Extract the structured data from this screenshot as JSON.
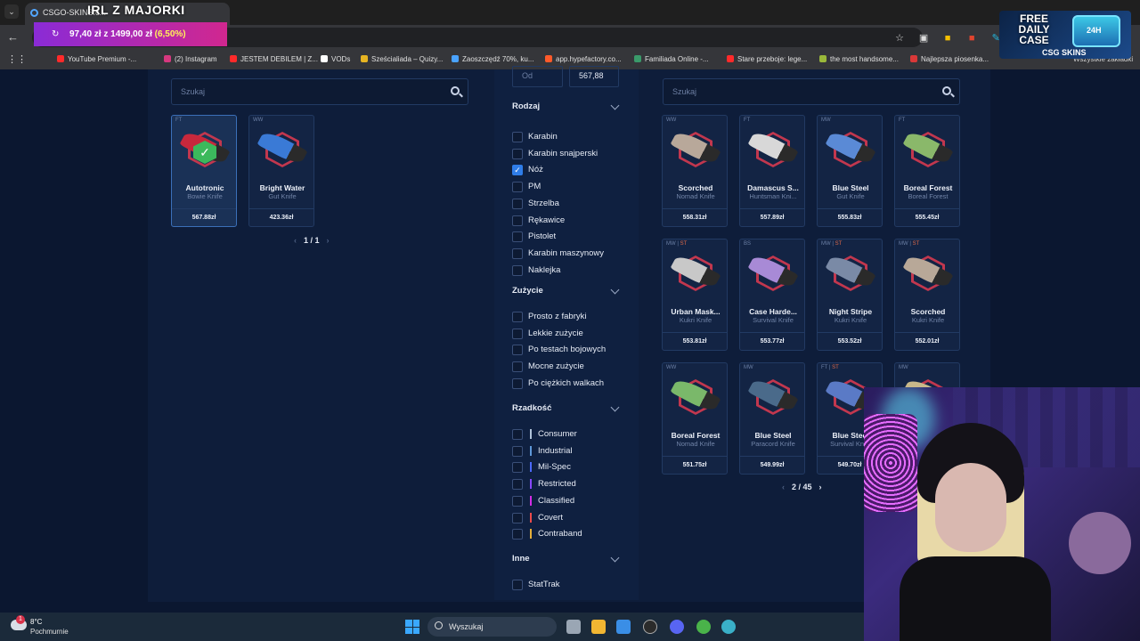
{
  "browser": {
    "tab_title": "CSGO-SKINS.c...",
    "stream_title": "IRL Z MAJORKI",
    "goal": {
      "text": "97,40 zł z 1499,00 zł",
      "percent": "(6,50%)"
    },
    "bookmarks": [
      {
        "label": "YouTube Premium -...",
        "color": "#ff2a2a"
      },
      {
        "label": "(2) Instagram",
        "color": "#d6387f"
      },
      {
        "label": "JESTEM DEBILEM | Z...",
        "color": "#ff2a2a"
      },
      {
        "label": "VODs",
        "color": "#ffffff"
      },
      {
        "label": "Sześcialiada – Quizy...",
        "color": "#e6b422"
      },
      {
        "label": "Zaoszczędź 70%, ku...",
        "color": "#4aa3ff"
      },
      {
        "label": "app.hypefactory.co...",
        "color": "#ff5a2a"
      },
      {
        "label": "Familiada Online -...",
        "color": "#3a9a6a"
      },
      {
        "label": "Stare przeboje: lege...",
        "color": "#ff2a2a"
      },
      {
        "label": "the most handsome...",
        "color": "#9ab83a"
      },
      {
        "label": "Najlepsza piosenka...",
        "color": "#d93838"
      }
    ],
    "all_bookmarks": "Wszystkie zakładki",
    "promo": {
      "title": "FREE DAILY CASE",
      "logo": "CSG SKINS",
      "chest_label": "24H"
    }
  },
  "left": {
    "search_placeholder": "Szukaj",
    "items": [
      {
        "wear": "FT",
        "name": "Autotronic",
        "type": "Bowie Knife",
        "price": "567.88zł",
        "selected": true,
        "blade": "#c8283c"
      },
      {
        "wear": "WW",
        "name": "Bright Water",
        "type": "Gut Knife",
        "price": "423.36zł",
        "selected": false,
        "blade": "#3a7ad6"
      }
    ],
    "pager": {
      "current": "1",
      "total": "1"
    }
  },
  "filters": {
    "price_from_placeholder": "Od",
    "price_to": "567,88",
    "rodzaj": {
      "title": "Rodzaj",
      "options": [
        {
          "label": "Karabin",
          "checked": false
        },
        {
          "label": "Karabin snajperski",
          "checked": false
        },
        {
          "label": "Nóż",
          "checked": true
        },
        {
          "label": "PM",
          "checked": false
        },
        {
          "label": "Strzelba",
          "checked": false
        },
        {
          "label": "Rękawice",
          "checked": false
        },
        {
          "label": "Pistolet",
          "checked": false
        },
        {
          "label": "Karabin maszynowy",
          "checked": false
        },
        {
          "label": "Naklejka",
          "checked": false
        }
      ]
    },
    "zuzycie": {
      "title": "Zużycie",
      "options": [
        {
          "label": "Prosto z fabryki",
          "checked": false
        },
        {
          "label": "Lekkie zużycie",
          "checked": false
        },
        {
          "label": "Po testach bojowych",
          "checked": false
        },
        {
          "label": "Mocne zużycie",
          "checked": false
        },
        {
          "label": "Po ciężkich walkach",
          "checked": false
        }
      ]
    },
    "rzadkosc": {
      "title": "Rzadkość",
      "options": [
        {
          "label": "Consumer",
          "color": "#b0c3d9"
        },
        {
          "label": "Industrial",
          "color": "#5e98d9"
        },
        {
          "label": "Mil-Spec",
          "color": "#4b69ff"
        },
        {
          "label": "Restricted",
          "color": "#8847ff"
        },
        {
          "label": "Classified",
          "color": "#d32ce6"
        },
        {
          "label": "Covert",
          "color": "#eb4b4b"
        },
        {
          "label": "Contraband",
          "color": "#e4ae39"
        }
      ]
    },
    "inne": {
      "title": "Inne",
      "options": [
        {
          "label": "StatTrak",
          "checked": false
        }
      ]
    }
  },
  "right": {
    "search_placeholder": "Szukaj",
    "items": [
      {
        "wear": "WW",
        "st": "",
        "name": "Scorched",
        "type": "Nomad Knife",
        "price": "558.31zł",
        "blade": "#b8a89a"
      },
      {
        "wear": "FT",
        "st": "",
        "name": "Damascus S...",
        "type": "Huntsman Kni...",
        "price": "557.89zł",
        "blade": "#d8d8d8"
      },
      {
        "wear": "MW",
        "st": "",
        "name": "Blue Steel",
        "type": "Gut Knife",
        "price": "555.83zł",
        "blade": "#5a8ad6"
      },
      {
        "wear": "FT",
        "st": "",
        "name": "Boreal Forest",
        "type": "Boreal Forest",
        "price": "555.45zł",
        "blade": "#8ab86a"
      },
      {
        "wear": "MW",
        "st": "ST",
        "name": "Urban Mask...",
        "type": "Kukri Knife",
        "price": "553.81zł",
        "blade": "#c8c8c8"
      },
      {
        "wear": "BS",
        "st": "",
        "name": "Case Harde...",
        "type": "Survival Knife",
        "price": "553.77zł",
        "blade": "#a88ad6"
      },
      {
        "wear": "MW",
        "st": "ST",
        "name": "Night Stripe",
        "type": "Kukri Knife",
        "price": "553.52zł",
        "blade": "#7a8aa6"
      },
      {
        "wear": "MW",
        "st": "ST",
        "name": "Scorched",
        "type": "Kukri Knife",
        "price": "552.01zł",
        "blade": "#b8a898"
      },
      {
        "wear": "WW",
        "st": "",
        "name": "Boreal Forest",
        "type": "Nomad Knife",
        "price": "551.75zł",
        "blade": "#7ab86a"
      },
      {
        "wear": "MW",
        "st": "",
        "name": "Blue Steel",
        "type": "Paracord Knife",
        "price": "549.99zł",
        "blade": "#4a6a8a"
      },
      {
        "wear": "FT",
        "st": "ST",
        "name": "Blue Steel",
        "type": "Survival Kni...",
        "price": "549.70zł",
        "blade": "#5a7ac6"
      },
      {
        "wear": "MW",
        "st": "",
        "name": "",
        "type": "",
        "price": "",
        "blade": "#c8b88a"
      }
    ],
    "pager": {
      "current": "2",
      "total": "45"
    }
  },
  "taskbar": {
    "weather_temp": "8°C",
    "weather_desc": "Pochmurnie",
    "weather_badge": "1",
    "search_label": "Wyszukaj"
  }
}
